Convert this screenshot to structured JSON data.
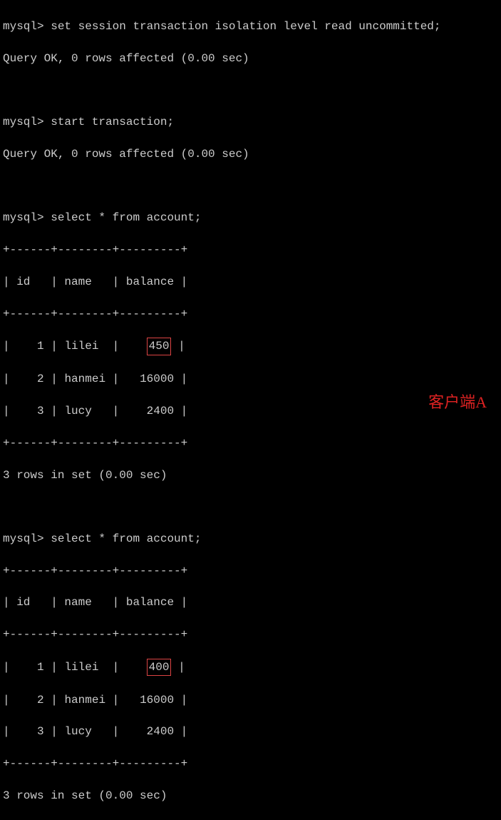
{
  "prompt": "mysql>",
  "commands": {
    "cmd1": "set session transaction isolation level read uncommitted;",
    "cmd2": "start transaction;",
    "cmd3": "select * from account;",
    "cmd4": "select * from account;"
  },
  "responses": {
    "query_ok": "Query OK, 0 rows affected (0.00 sec)",
    "rows_in_set": "3 rows in set (0.00 sec)"
  },
  "table": {
    "border": "+------+--------+---------+",
    "header_id": "id",
    "header_name": "name",
    "header_balance": "balance"
  },
  "query1": {
    "rows": [
      {
        "id": "1",
        "name": "lilei",
        "balance": "450"
      },
      {
        "id": "2",
        "name": "hanmei",
        "balance": "16000"
      },
      {
        "id": "3",
        "name": "lucy",
        "balance": "2400"
      }
    ]
  },
  "query2": {
    "rows": [
      {
        "id": "1",
        "name": "lilei",
        "balance": "400"
      },
      {
        "id": "2",
        "name": "hanmei",
        "balance": "16000"
      },
      {
        "id": "3",
        "name": "lucy",
        "balance": "2400"
      }
    ]
  },
  "client_label": "客户端A"
}
